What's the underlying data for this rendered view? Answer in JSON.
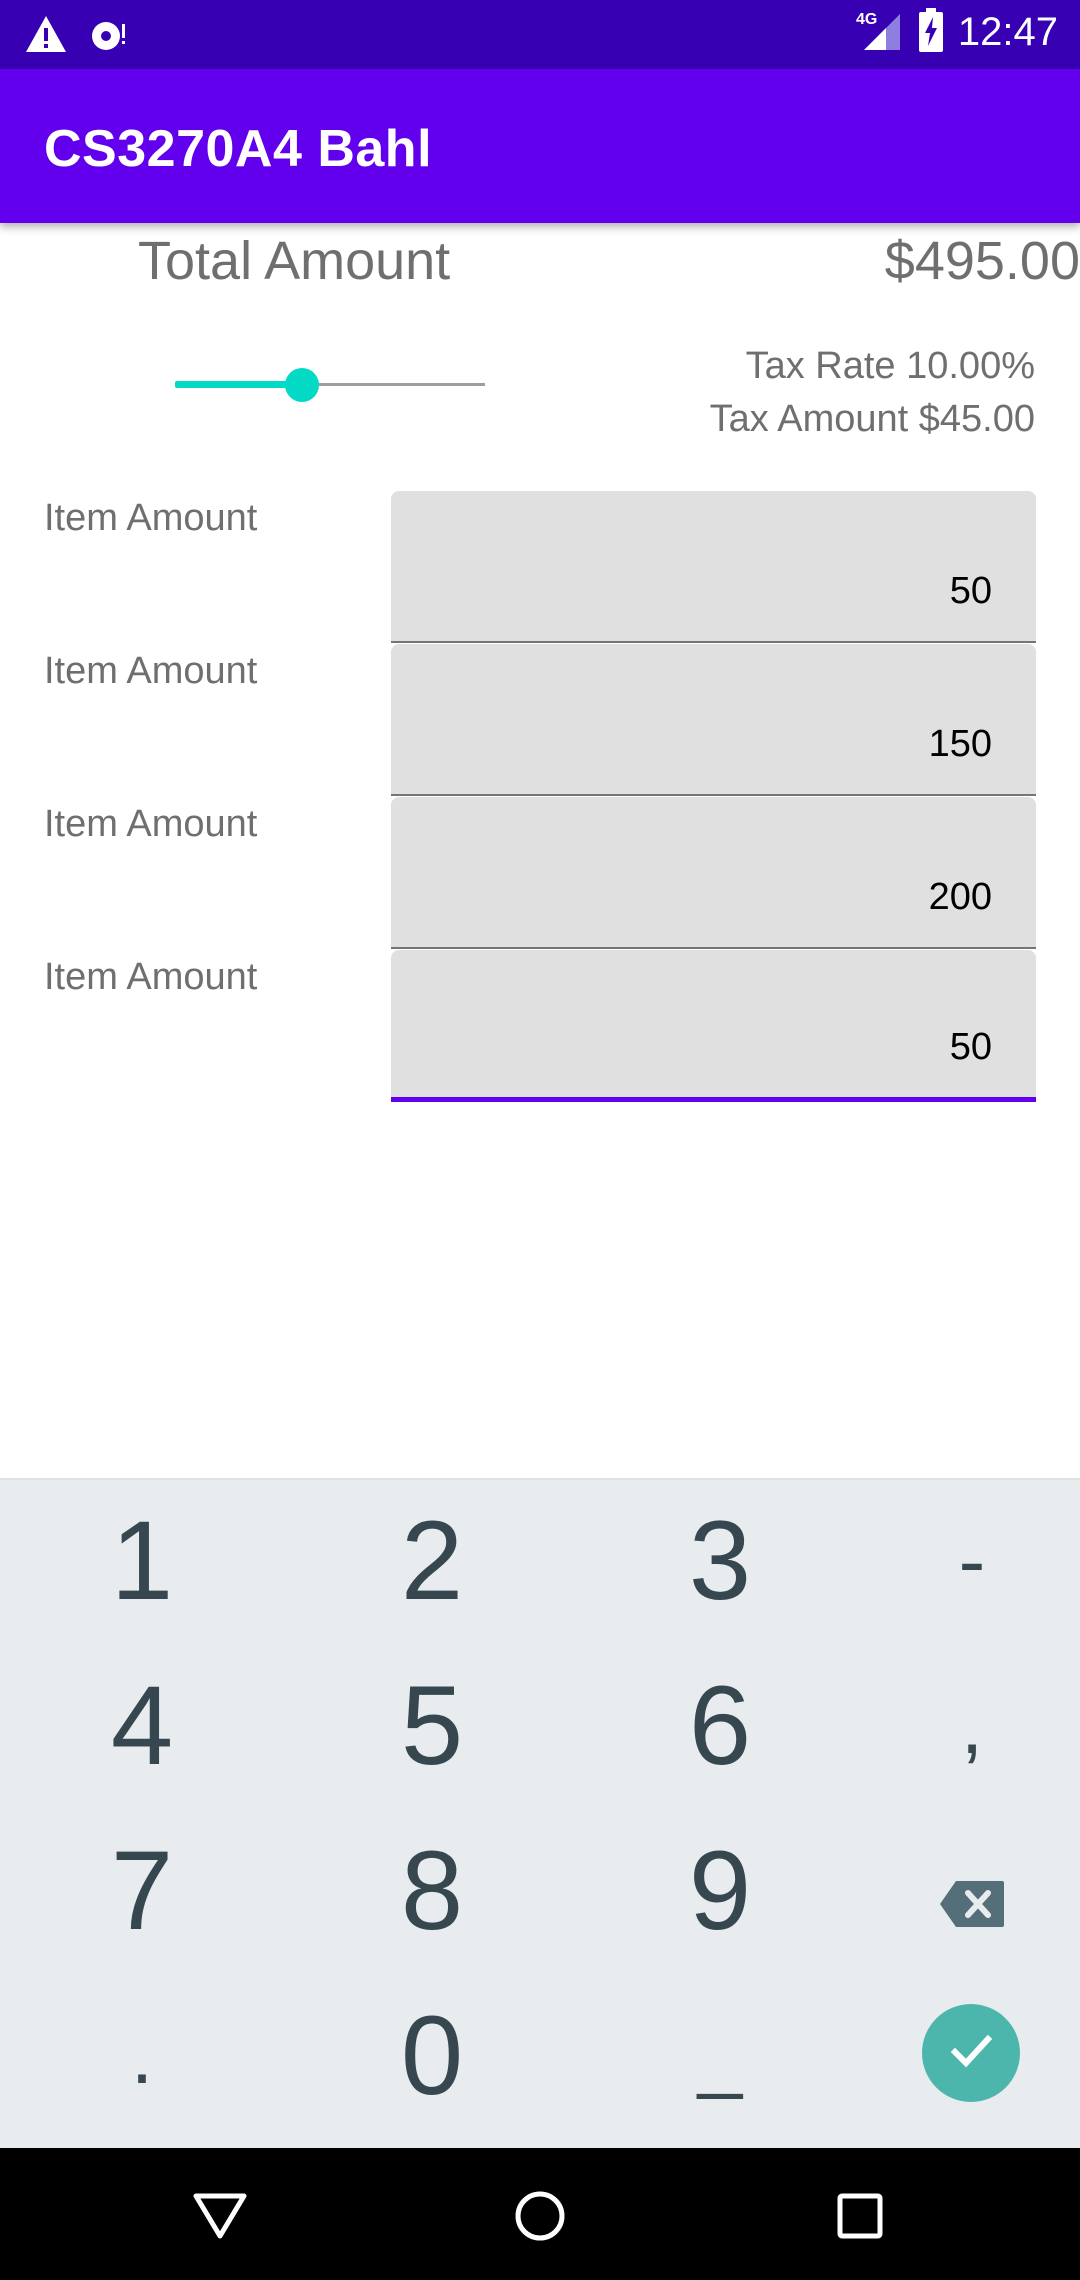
{
  "status_bar": {
    "time": "12:47",
    "network": "4G",
    "icons": [
      "warning-icon",
      "sync-disk-icon",
      "signal-icon",
      "battery-charging-icon"
    ]
  },
  "app_bar": {
    "title": "CS3270A4 Bahl"
  },
  "total": {
    "label": "Total Amount",
    "value": "$495.00"
  },
  "tax": {
    "slider_value_fraction": 0.41,
    "rate_text": "Tax Rate 10.00%",
    "amount_text": "Tax Amount $45.00"
  },
  "items": [
    {
      "label": "Item Amount",
      "value": "50"
    },
    {
      "label": "Item Amount",
      "value": "150"
    },
    {
      "label": "Item Amount",
      "value": "200"
    },
    {
      "label": "Item Amount",
      "value": "50"
    }
  ],
  "keyboard": {
    "keys": [
      "1",
      "2",
      "3",
      "-",
      "4",
      "5",
      "6",
      ",",
      "7",
      "8",
      "9",
      "backspace",
      ".",
      "0",
      "_",
      "done"
    ],
    "done_icon": "check-icon",
    "backspace_icon": "backspace-icon",
    "accent_color": "#4db6ac"
  },
  "nav_bar": {
    "icons": [
      "back-triangle-icon",
      "home-circle-icon",
      "recents-square-icon"
    ]
  },
  "colors": {
    "status_bar": "#3700b3",
    "app_bar": "#6200ee",
    "slider": "#03dac5"
  }
}
